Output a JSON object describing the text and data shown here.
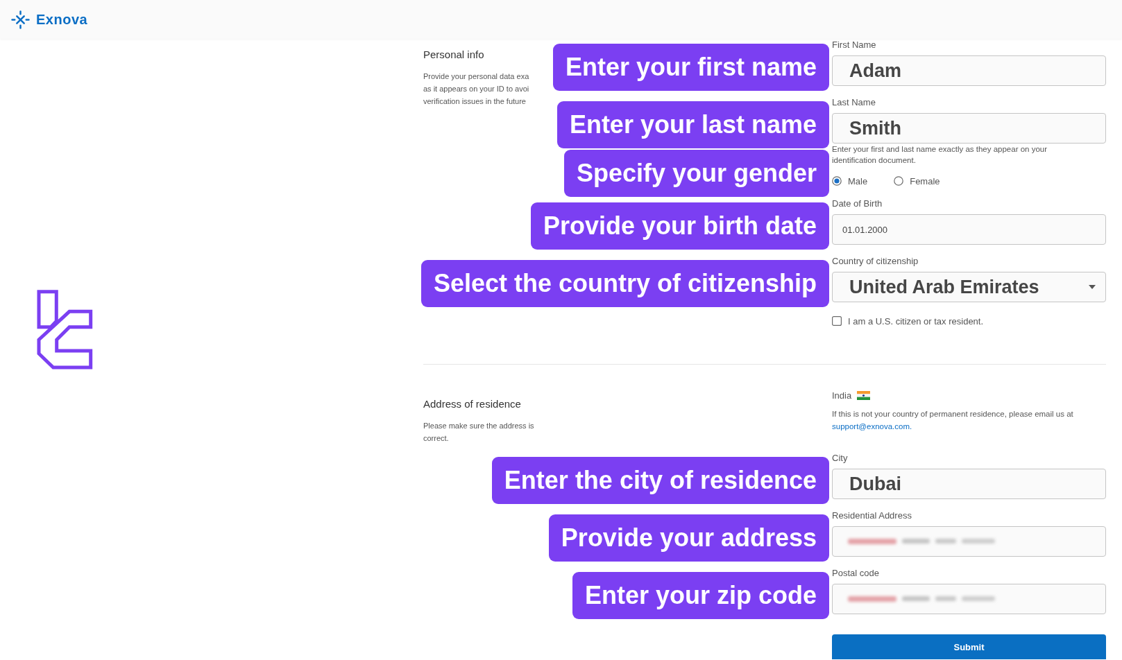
{
  "top_bar": {
    "brand": "Exnova"
  },
  "sections": [
    {
      "title": "Personal info",
      "description": "Provide your personal data exa\nas it appears on your ID to avoi\nverification issues in the future",
      "items": [
        {
          "kind": "field",
          "label": "First Name",
          "value": "Adam",
          "emphasized": true,
          "blurred": false,
          "callout": "Enter your first name"
        },
        {
          "kind": "field",
          "label": "Last Name",
          "value": "Smith",
          "emphasized": true,
          "blurred": false,
          "callout": "Enter your last name"
        },
        {
          "kind": "hint",
          "text": "Enter your first and last name exactly as they appear on your identification document."
        },
        {
          "kind": "radio_group",
          "options": [
            {
              "label": "Male",
              "selected": true
            },
            {
              "label": "Female",
              "selected": false
            }
          ],
          "callout": "Specify your gender"
        },
        {
          "kind": "field",
          "label": "Date of Birth",
          "value": "01.01.2000",
          "emphasized": false,
          "blurred": false,
          "callout": "Provide your birth date"
        },
        {
          "kind": "select",
          "label": "Country of citizenship",
          "value": "United Arab Emirates",
          "emphasized": true,
          "blurred": false,
          "callout": "Select the country of citizenship"
        },
        {
          "kind": "checkbox",
          "label": "I am a U.S. citizen or tax resident.",
          "checked": false
        }
      ]
    },
    {
      "title": "Address of residence",
      "description": "Please make sure the address is correct.",
      "items": [
        {
          "kind": "country",
          "label": "India"
        },
        {
          "kind": "note",
          "text": "If this is not your country of permanent residence, please email us at",
          "link": "support@exnova.com."
        },
        {
          "kind": "field",
          "label": "City",
          "value": "Dubai",
          "emphasized": true,
          "blurred": false,
          "callout": "Enter the city of residence"
        },
        {
          "kind": "field",
          "label": "Residential Address",
          "emphasized": false,
          "blurred": true,
          "callout": "Provide your address"
        },
        {
          "kind": "field",
          "label": "Postal code",
          "emphasized": false,
          "blurred": true,
          "callout": "Enter your zip code"
        },
        {
          "kind": "button",
          "label": "Submit"
        }
      ]
    }
  ]
}
